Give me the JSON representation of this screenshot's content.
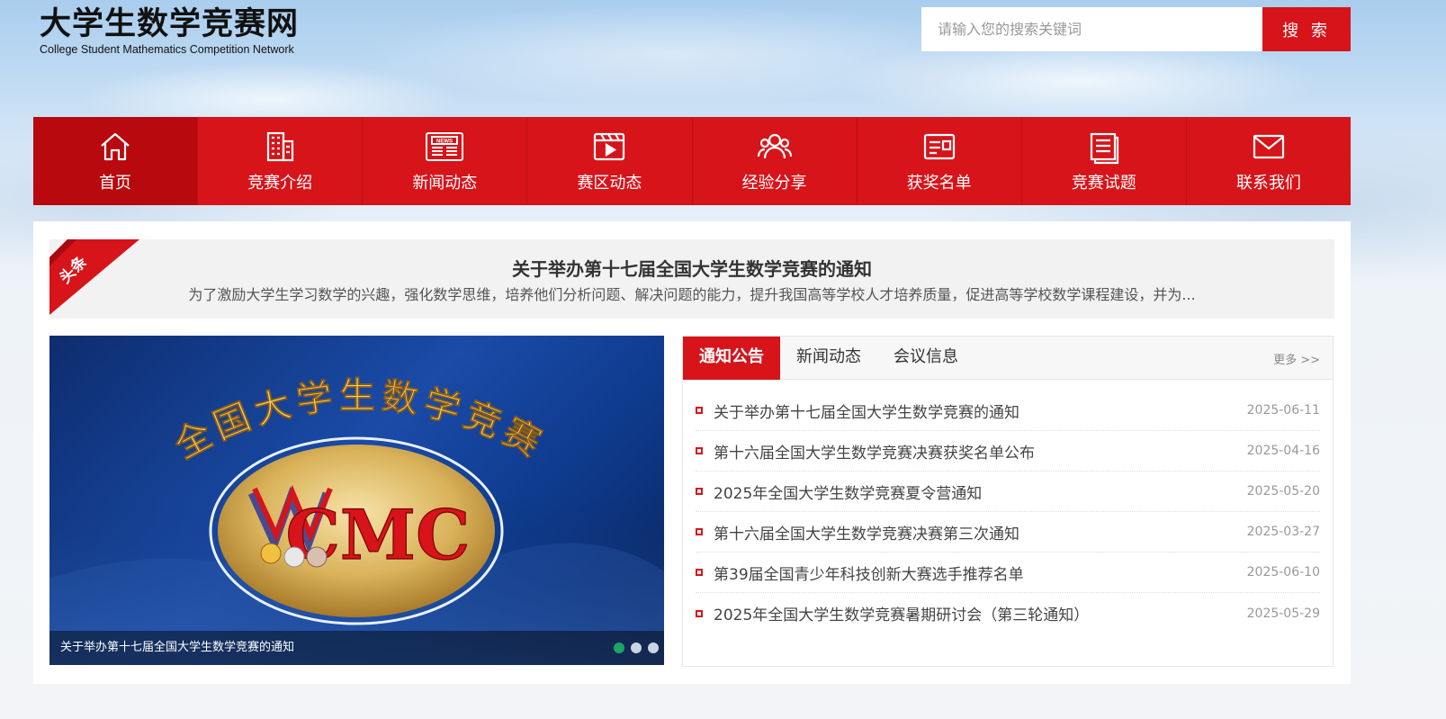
{
  "site": {
    "title": "大学生数学竞赛网",
    "subtitle": "College Student Mathematics Competition Network"
  },
  "search": {
    "placeholder": "请输入您的搜索关键词",
    "button_label": "搜 索"
  },
  "nav": {
    "items": [
      {
        "label": "首页",
        "icon": "home-icon"
      },
      {
        "label": "竞赛介绍",
        "icon": "building-icon"
      },
      {
        "label": "新闻动态",
        "icon": "newspaper-icon"
      },
      {
        "label": "赛区动态",
        "icon": "video-icon"
      },
      {
        "label": "经验分享",
        "icon": "users-icon"
      },
      {
        "label": "获奖名单",
        "icon": "id-card-icon"
      },
      {
        "label": "竞赛试题",
        "icon": "document-icon"
      },
      {
        "label": "联系我们",
        "icon": "mail-icon"
      }
    ]
  },
  "headline": {
    "ribbon": "头条",
    "title": "关于举办第十七届全国大学生数学竞赛的通知",
    "desc": "为了激励大学生学习数学的兴趣，强化数学思维，培养他们分析问题、解决问题的能力，提升我国高等学校人才培养质量，促进高等学校数学课程建设，并为..."
  },
  "slider": {
    "banner_text": "全国大学生数学竞赛",
    "logo_text": "CMC",
    "caption": "关于举办第十七届全国大学生数学竞赛的通知"
  },
  "news": {
    "tabs": [
      "通知公告",
      "新闻动态",
      "会议信息"
    ],
    "more": "更多 >>",
    "items": [
      {
        "title": "关于举办第十七届全国大学生数学竞赛的通知",
        "date": "2025-06-11"
      },
      {
        "title": "第十六届全国大学生数学竞赛决赛获奖名单公布",
        "date": "2025-04-16"
      },
      {
        "title": "2025年全国大学生数学竞赛夏令营通知",
        "date": "2025-05-20"
      },
      {
        "title": "第十六届全国大学生数学竞赛决赛第三次通知",
        "date": "2025-03-27"
      },
      {
        "title": "第39届全国青少年科技创新大赛选手推荐名单",
        "date": "2025-06-10"
      },
      {
        "title": "2025年全国大学生数学竞赛暑期研讨会（第三轮通知）",
        "date": "2025-05-29"
      }
    ]
  },
  "colors": {
    "brand_red": "#d6141a",
    "active_green": "#1aa56a"
  }
}
